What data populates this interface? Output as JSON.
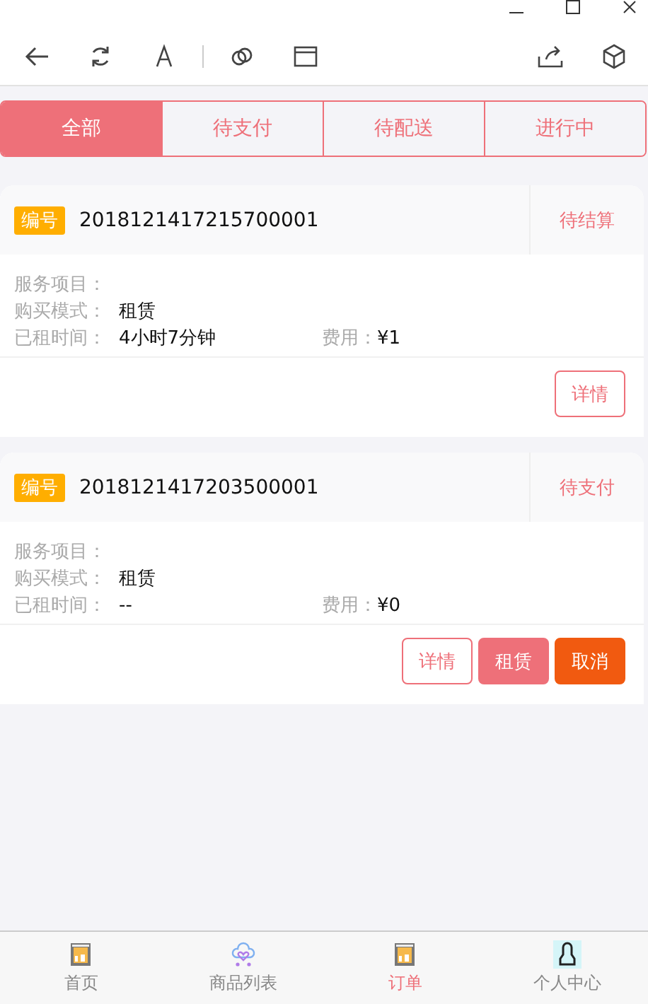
{
  "tabs": [
    {
      "label": "全部",
      "selected": true
    },
    {
      "label": "待支付",
      "selected": false
    },
    {
      "label": "待配送",
      "selected": false
    },
    {
      "label": "进行中",
      "selected": false
    }
  ],
  "orders": [
    {
      "badge": "编号",
      "number": "2018121417215700001",
      "status": "待结算",
      "fields": [
        {
          "label": "服务项目："
        },
        {
          "label": "购买模式：",
          "value": "租赁"
        }
      ],
      "time_label": "已租时间：",
      "time_value": "4小时7分钟",
      "fee_label": "费用：",
      "fee_value": "¥1",
      "buttons": [
        {
          "label": "详情",
          "kind": "outline"
        }
      ]
    },
    {
      "badge": "编号",
      "number": "2018121417203500001",
      "status": "待支付",
      "fields": [
        {
          "label": "服务项目："
        },
        {
          "label": "购买模式：",
          "value": "租赁"
        }
      ],
      "time_label": "已租时间：",
      "time_value": "--",
      "fee_label": "费用：",
      "fee_value": "¥0",
      "buttons": [
        {
          "label": "详情",
          "kind": "outline"
        },
        {
          "label": "租赁",
          "kind": "primary"
        },
        {
          "label": "取消",
          "kind": "danger"
        }
      ]
    }
  ],
  "bottom_nav": [
    {
      "label": "首页",
      "kind": "box",
      "selected": false
    },
    {
      "label": "商品列表",
      "kind": "cloud",
      "selected": false
    },
    {
      "label": "订单",
      "kind": "box",
      "selected": true
    },
    {
      "label": "个人中心",
      "kind": "person",
      "selected": false
    }
  ]
}
